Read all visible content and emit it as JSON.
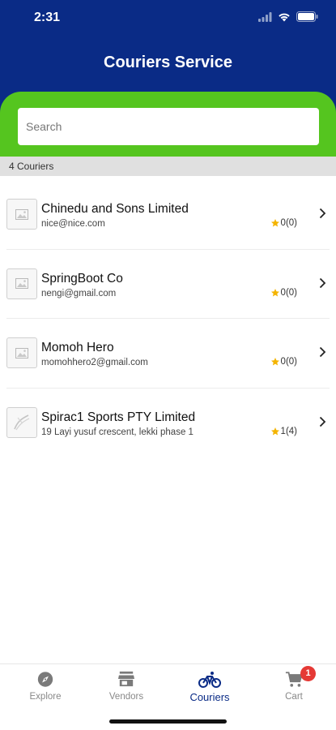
{
  "status_bar": {
    "time": "2:31"
  },
  "header": {
    "title": "Couriers Service"
  },
  "search": {
    "placeholder": "Search"
  },
  "list_count": "4 Couriers",
  "couriers": [
    {
      "name": "Chinedu and Sons Limited",
      "subtitle": "nice@nice.com",
      "rating": "0(0)"
    },
    {
      "name": "SpringBoot Co",
      "subtitle": "nengi@gmail.com",
      "rating": "0(0)"
    },
    {
      "name": "Momoh Hero",
      "subtitle": "momohhero2@gmail.com",
      "rating": "0(0)"
    },
    {
      "name": "Spirac1 Sports PTY Limited",
      "subtitle": "19 Layi yusuf crescent, lekki phase 1",
      "rating": "1(4)"
    }
  ],
  "tabs": [
    {
      "label": "Explore",
      "icon": "compass-icon"
    },
    {
      "label": "Vendors",
      "icon": "store-icon"
    },
    {
      "label": "Couriers",
      "icon": "bicycle-icon",
      "active": true
    },
    {
      "label": "Cart",
      "icon": "cart-icon",
      "badge": "1"
    }
  ],
  "colors": {
    "header": "#0a2b86",
    "search_band": "#55c51f",
    "star": "#f4b400",
    "badge": "#e53935",
    "active_tab": "#0a2b86"
  }
}
